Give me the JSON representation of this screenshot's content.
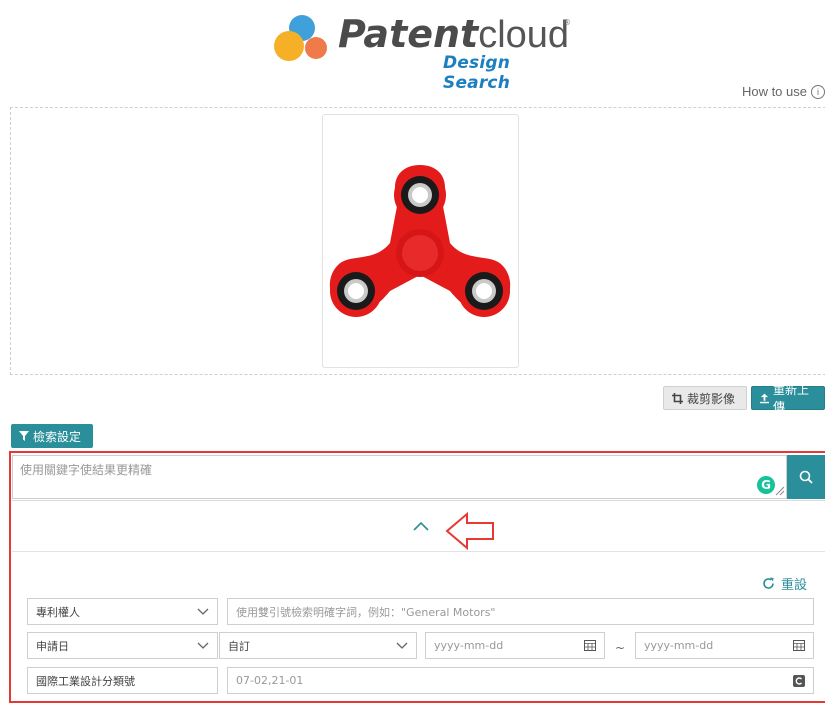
{
  "logo": {
    "word_bold": "Patent",
    "word_light": "cloud",
    "registered": "®",
    "subtitle": "Design Search"
  },
  "help": {
    "label": "How to use"
  },
  "toolbar": {
    "crop_label": "裁剪影像",
    "reupload_label": "重新上傳"
  },
  "settings": {
    "label": "檢索設定"
  },
  "search": {
    "placeholder": "使用關鍵字使結果更精確",
    "grammarly_badge": "G"
  },
  "filters": {
    "reset_label": "重設",
    "row1": {
      "field_select": "專利權人",
      "query_placeholder": "使用雙引號檢索明確字詞，例如：\"General Motors\""
    },
    "row2": {
      "field_select": "申請日",
      "range_select": "自訂",
      "date_from_placeholder": "yyyy-mm-dd",
      "separator": "~",
      "date_to_placeholder": "yyyy-mm-dd"
    },
    "row3": {
      "label": "國際工業設計分類號",
      "value": "07-02,21-01"
    }
  },
  "colors": {
    "accent": "#2a8f9a",
    "highlight_border": "#e53935",
    "logo_blue": "#1d7fbf",
    "spinner_red": "#e41b1b"
  }
}
